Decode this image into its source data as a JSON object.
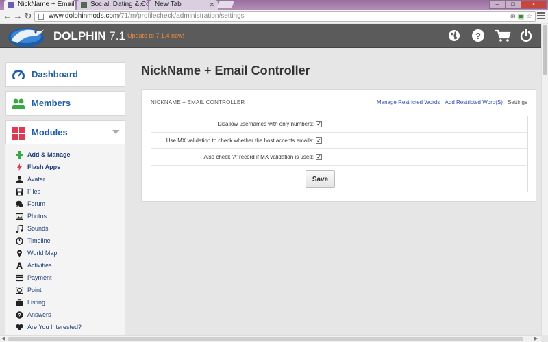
{
  "browser": {
    "tabs": [
      {
        "title": "NickName + Email C",
        "active": true
      },
      {
        "title": "Social, Dating & Cor",
        "active": false
      },
      {
        "title": "New Tab",
        "active": false
      }
    ],
    "window_controls": {
      "minimize": "–",
      "maximize": "□",
      "close": "×"
    },
    "url_main": "www.dolphinmods.com",
    "url_rest": "/71/m/profilecheck/administration/settings"
  },
  "header": {
    "brand": "DOLPHIN",
    "version": "7.1",
    "update_link": "Update to 7.1.4 now!",
    "icons": [
      "globe-icon",
      "help-icon",
      "cart-icon",
      "power-icon"
    ]
  },
  "sidebar": {
    "dashboard": "Dashboard",
    "members": "Members",
    "modules": "Modules",
    "module_items": [
      {
        "label": "Add & Manage",
        "icon": "plus-icon",
        "bold": true
      },
      {
        "label": "Flash Apps",
        "icon": "lightning-icon",
        "bold": true
      },
      {
        "label": "Avatar",
        "icon": "person-icon",
        "bold": false
      },
      {
        "label": "Files",
        "icon": "disk-icon",
        "bold": false
      },
      {
        "label": "Forum",
        "icon": "comments-icon",
        "bold": false
      },
      {
        "label": "Photos",
        "icon": "photo-icon",
        "bold": false
      },
      {
        "label": "Sounds",
        "icon": "music-icon",
        "bold": false
      },
      {
        "label": "Timeline",
        "icon": "clock-icon",
        "bold": false
      },
      {
        "label": "World Map",
        "icon": "map-pin-icon",
        "bold": false
      },
      {
        "label": "Activities",
        "icon": "activities-icon",
        "bold": false
      },
      {
        "label": "Payment",
        "icon": "credit-card-icon",
        "bold": false
      },
      {
        "label": "Point",
        "icon": "point-icon",
        "bold": false
      },
      {
        "label": "Listing",
        "icon": "briefcase-icon",
        "bold": false
      },
      {
        "label": "Answers",
        "icon": "question-icon",
        "bold": false
      },
      {
        "label": "Are You Interested?",
        "icon": "heart-icon",
        "bold": false
      }
    ]
  },
  "main": {
    "title": "NickName + Email Controller",
    "panel_title": "NICKNAME + EMAIL CONTROLLER",
    "links": {
      "manage_restricted": "Manage Restricted Words",
      "add_restricted": "Add Restricted Word(S)",
      "settings": "Settings"
    },
    "settings": [
      {
        "label": "Disallow usernames with only numbers:",
        "checked": true
      },
      {
        "label": "Use MX validation to check whether the host accepts emails:",
        "checked": true
      },
      {
        "label": "Also check 'A' record if MX validation is used:",
        "checked": true
      }
    ],
    "save_label": "Save"
  },
  "colors": {
    "accent_blue": "#1f5ea8",
    "update_orange": "#f08a3b",
    "header_gray": "#5b5b5b",
    "modules_red": "#e03a52",
    "members_green": "#3aa845"
  }
}
